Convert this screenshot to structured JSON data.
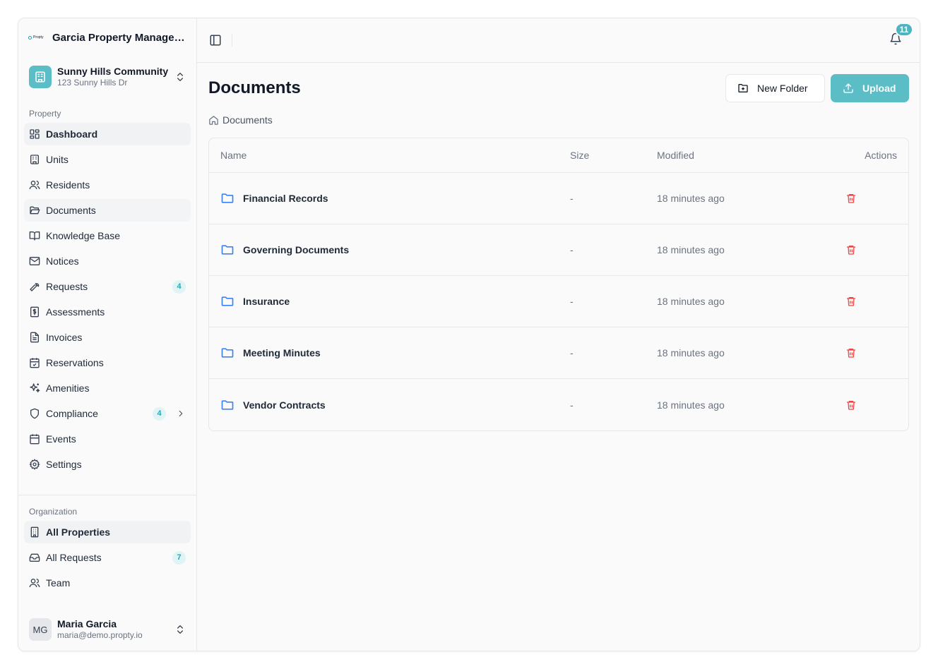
{
  "brand": {
    "logo_text": "Propty",
    "name": "Garcia Property Managem..."
  },
  "property_switcher": {
    "name": "Sunny Hills Community",
    "address": "123 Sunny Hills Dr"
  },
  "property_section": {
    "label": "Property",
    "items": [
      {
        "label": "Dashboard",
        "icon": "dashboard-icon"
      },
      {
        "label": "Units",
        "icon": "building-icon"
      },
      {
        "label": "Residents",
        "icon": "users-icon"
      },
      {
        "label": "Documents",
        "icon": "folder-open-icon"
      },
      {
        "label": "Knowledge Base",
        "icon": "book-icon"
      },
      {
        "label": "Notices",
        "icon": "mail-icon"
      },
      {
        "label": "Requests",
        "icon": "wrench-icon",
        "badge": "4"
      },
      {
        "label": "Assessments",
        "icon": "dollar-icon"
      },
      {
        "label": "Invoices",
        "icon": "file-icon"
      },
      {
        "label": "Reservations",
        "icon": "calendar-check-icon"
      },
      {
        "label": "Amenities",
        "icon": "sparkles-icon"
      },
      {
        "label": "Compliance",
        "icon": "shield-icon",
        "badge": "4"
      },
      {
        "label": "Events",
        "icon": "calendar-icon"
      },
      {
        "label": "Settings",
        "icon": "gear-icon"
      }
    ]
  },
  "organization_section": {
    "label": "Organization",
    "items": [
      {
        "label": "All Properties",
        "icon": "building-2-icon"
      },
      {
        "label": "All Requests",
        "icon": "inbox-icon",
        "badge": "7"
      },
      {
        "label": "Team",
        "icon": "users-icon"
      }
    ]
  },
  "user": {
    "initials": "MG",
    "name": "Maria Garcia",
    "email": "maria@demo.propty.io"
  },
  "topbar": {
    "notification_count": "11"
  },
  "page": {
    "title": "Documents",
    "new_folder_label": "New Folder",
    "upload_label": "Upload",
    "breadcrumb": "Documents"
  },
  "table": {
    "headers": {
      "name": "Name",
      "size": "Size",
      "modified": "Modified",
      "actions": "Actions"
    },
    "rows": [
      {
        "name": "Financial Records",
        "size": "-",
        "modified": "18 minutes ago"
      },
      {
        "name": "Governing Documents",
        "size": "-",
        "modified": "18 minutes ago"
      },
      {
        "name": "Insurance",
        "size": "-",
        "modified": "18 minutes ago"
      },
      {
        "name": "Meeting Minutes",
        "size": "-",
        "modified": "18 minutes ago"
      },
      {
        "name": "Vendor Contracts",
        "size": "-",
        "modified": "18 minutes ago"
      }
    ]
  },
  "colors": {
    "accent": "#5bbdc6",
    "folder": "#3b82f6",
    "danger": "#ef4444"
  }
}
